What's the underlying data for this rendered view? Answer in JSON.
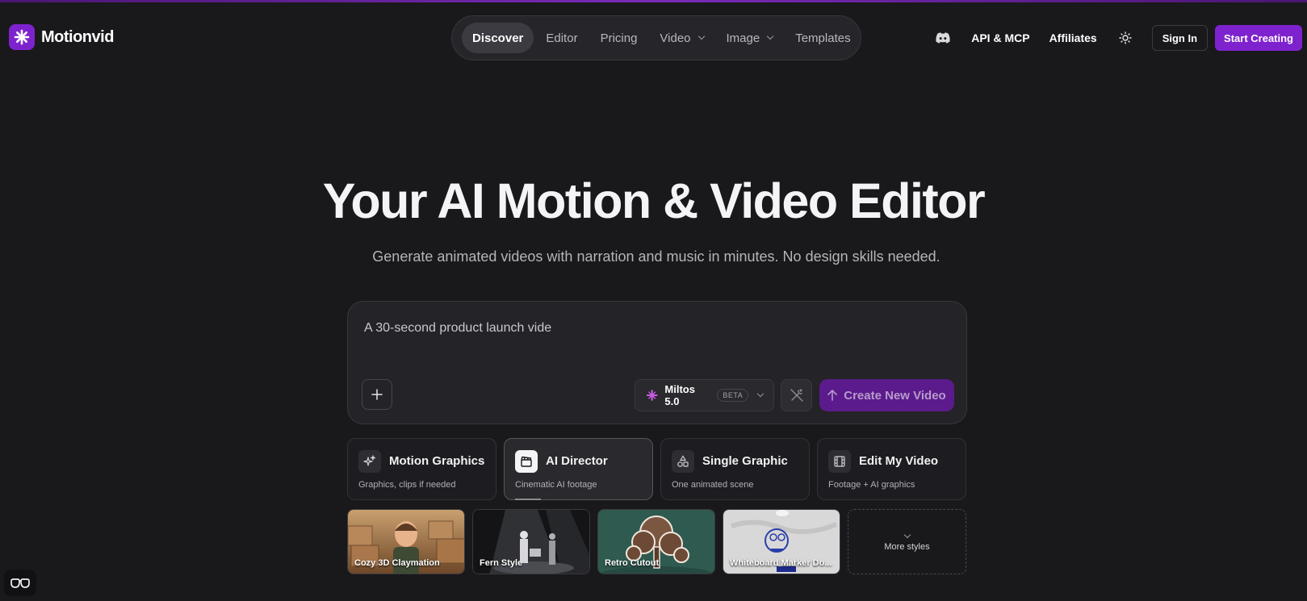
{
  "brand": {
    "name": "Motionvid",
    "accent": "#7e22ce"
  },
  "nav": {
    "items": [
      {
        "label": "Discover",
        "active": true
      },
      {
        "label": "Editor"
      },
      {
        "label": "Pricing"
      },
      {
        "label": "Video",
        "dropdown": true
      },
      {
        "label": "Image",
        "dropdown": true
      },
      {
        "label": "Templates"
      }
    ]
  },
  "header": {
    "discord_icon": "discord-icon",
    "api_label": "API & MCP",
    "affiliates_label": "Affiliates",
    "theme_icon": "sun-icon",
    "signin_label": "Sign In",
    "start_label": "Start Creating"
  },
  "hero": {
    "title": "Your AI Motion & Video Editor",
    "subtitle": "Generate animated videos with narration and music in minutes. No design skills needed."
  },
  "prompt": {
    "value": "A 30-second product launch vide",
    "attach_icon": "plus-icon",
    "model": "Miltos 5.0",
    "model_badge": "BETA",
    "enhance_icon": "magic-wand-icon",
    "create_label": "Create New Video"
  },
  "modes": [
    {
      "title": "Motion Graphics",
      "subtitle": "Graphics, clips if needed",
      "icon": "sparkles-icon"
    },
    {
      "title": "AI Director",
      "subtitle": "Cinematic AI footage",
      "icon": "clapperboard-icon",
      "active": true
    },
    {
      "title": "Single Graphic",
      "subtitle": "One animated scene",
      "icon": "shapes-icon"
    },
    {
      "title": "Edit My Video",
      "subtitle": "Footage + AI graphics",
      "icon": "film-icon"
    }
  ],
  "styles": [
    {
      "label": "Cozy 3D Claymation"
    },
    {
      "label": "Fern Style"
    },
    {
      "label": "Retro Cutout"
    },
    {
      "label": "Whiteboard Marker Do..."
    }
  ],
  "more_styles_label": "More styles",
  "corner_icon": "glasses-icon"
}
